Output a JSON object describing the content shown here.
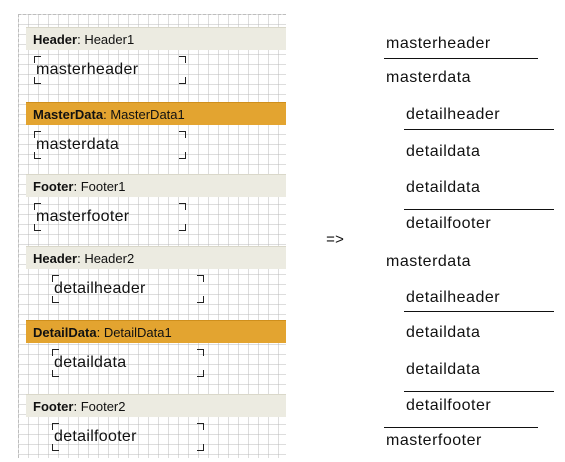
{
  "bands": [
    {
      "type": "Header",
      "name": "Header1",
      "style": "light",
      "field": "masterheader"
    },
    {
      "type": "MasterData",
      "name": "MasterData1",
      "style": "orange",
      "field": "masterdata"
    },
    {
      "type": "Footer",
      "name": "Footer1",
      "style": "light",
      "field": "masterfooter"
    },
    {
      "type": "Header",
      "name": "Header2",
      "style": "light",
      "field": "detailheader"
    },
    {
      "type": "DetailData",
      "name": "DetailData1",
      "style": "orange",
      "field": "detaildata"
    },
    {
      "type": "Footer",
      "name": "Footer2",
      "style": "light",
      "field": "detailfooter"
    }
  ],
  "arrow": "=>",
  "output": [
    {
      "text": "masterheader",
      "indent": false,
      "underline": true
    },
    {
      "text": "masterdata",
      "indent": false,
      "underline": false
    },
    {
      "text": "detailheader",
      "indent": true,
      "underline": true
    },
    {
      "text": "detaildata",
      "indent": true,
      "underline": false
    },
    {
      "text": "detaildata",
      "indent": true,
      "underline": false
    },
    {
      "text": "detailfooter",
      "indent": true,
      "overline": true
    },
    {
      "text": "masterdata",
      "indent": false,
      "underline": false
    },
    {
      "text": "detailheader",
      "indent": true,
      "underline": true
    },
    {
      "text": "detaildata",
      "indent": true,
      "underline": false
    },
    {
      "text": "detaildata",
      "indent": true,
      "underline": false
    },
    {
      "text": "detailfooter",
      "indent": true,
      "overline": true
    },
    {
      "text": "masterfooter",
      "indent": false,
      "overline": true
    }
  ],
  "colors": {
    "band_light": "#ecebe1",
    "band_orange": "#e3a430"
  }
}
